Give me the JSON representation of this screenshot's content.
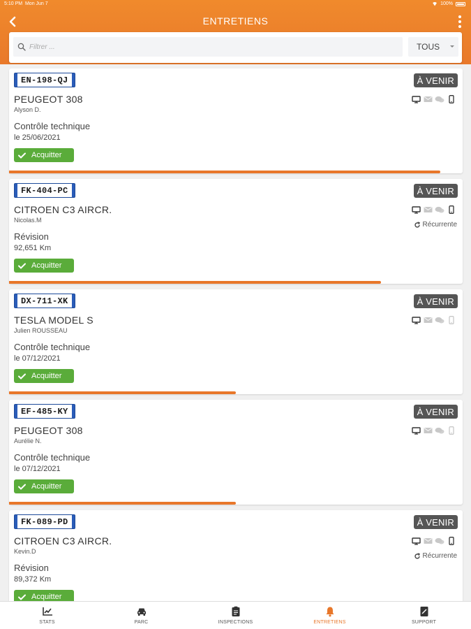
{
  "status_bar": {
    "time": "5:10 PM",
    "date": "Mon Jun 7",
    "battery": "100%"
  },
  "header": {
    "title": "ENTRETIENS"
  },
  "search": {
    "placeholder": "Filtrer ...",
    "value": "",
    "filter_selected": "TOUS"
  },
  "colors": {
    "accent": "#e8772a",
    "ack_green": "#5aac3a",
    "badge_gray": "#555555",
    "plate_blue": "#2a5cb8"
  },
  "cards": [
    {
      "plate": "EN-198-QJ",
      "status": "À VENIR",
      "model": "PEUGEOT 308",
      "driver": "Alyson D.",
      "task": "Contrôle technique",
      "detail": "le 25/06/2021",
      "ack_label": "Acquitter",
      "recurrent": "",
      "progress": 0.95,
      "channels": [
        "screen",
        "mail",
        "chat",
        "phone"
      ],
      "channels_active": [
        true,
        false,
        false,
        true
      ]
    },
    {
      "plate": "FK-404-PC",
      "status": "À VENIR",
      "model": "CITROEN C3 AIRCR.",
      "driver": "Nicolas.M",
      "task": "Révision",
      "detail": "92,651 Km",
      "ack_label": "Acquitter",
      "recurrent": "Récurrente",
      "progress": 0.82,
      "channels": [
        "screen",
        "mail",
        "chat",
        "phone"
      ],
      "channels_active": [
        true,
        false,
        false,
        true
      ]
    },
    {
      "plate": "DX-711-XK",
      "status": "À VENIR",
      "model": "TESLA MODEL S",
      "driver": "Julien ROUSSEAU",
      "task": "Contrôle technique",
      "detail": "le 07/12/2021",
      "ack_label": "Acquitter",
      "recurrent": "",
      "progress": 0.5,
      "channels": [
        "screen",
        "mail",
        "chat",
        "phone"
      ],
      "channels_active": [
        true,
        false,
        false,
        false
      ]
    },
    {
      "plate": "EF-485-KY",
      "status": "À VENIR",
      "model": "PEUGEOT 308",
      "driver": "Aurélie N.",
      "task": "Contrôle technique",
      "detail": "le 07/12/2021",
      "ack_label": "Acquitter",
      "recurrent": "",
      "progress": 0.5,
      "channels": [
        "screen",
        "mail",
        "chat",
        "phone"
      ],
      "channels_active": [
        true,
        false,
        false,
        false
      ]
    },
    {
      "plate": "FK-089-PD",
      "status": "À VENIR",
      "model": "CITROEN C3 AIRCR.",
      "driver": "Kevin.D",
      "task": "Révision",
      "detail": "89,372 Km",
      "ack_label": "Acquitter",
      "recurrent": "Récurrente",
      "progress": 0.0,
      "channels": [
        "screen",
        "mail",
        "chat",
        "phone"
      ],
      "channels_active": [
        true,
        false,
        false,
        true
      ]
    }
  ],
  "tabs": [
    {
      "label": "STATS",
      "icon": "chart-icon",
      "active": false
    },
    {
      "label": "PARC",
      "icon": "car-icon",
      "active": false
    },
    {
      "label": "INSPECTIONS",
      "icon": "clipboard-icon",
      "active": false
    },
    {
      "label": "ENTRETIENS",
      "icon": "bell-icon",
      "active": true
    },
    {
      "label": "SUPPORT",
      "icon": "support-icon",
      "active": false
    }
  ]
}
